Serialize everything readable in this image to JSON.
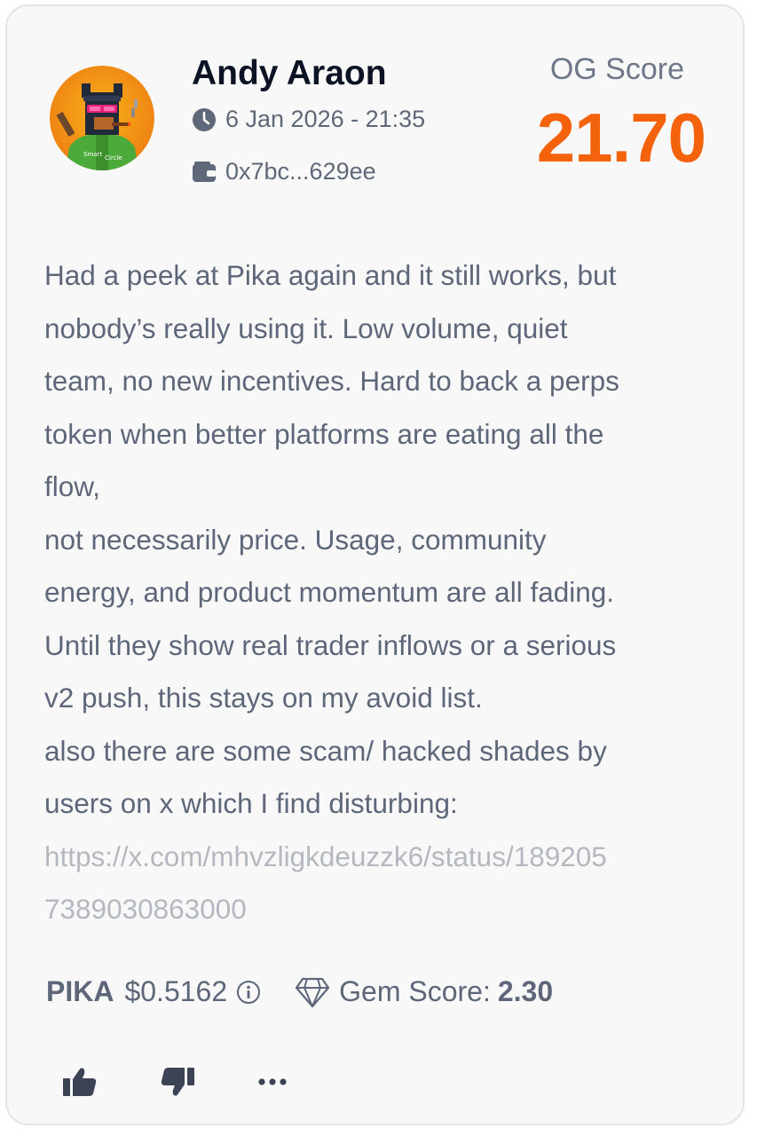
{
  "post": {
    "author": {
      "name": "Andy Araon",
      "avatar_icon": "pixel-dog-avatar",
      "avatar_caption": "Smart Circle"
    },
    "timestamp": "6 Jan 2026 - 21:35",
    "wallet": "0x7bc...629ee",
    "og_score": {
      "label": "OG Score",
      "value": "21.70",
      "color": "#f5620c"
    },
    "body_lines": [
      "Had a peek at Pika again and it still works, but",
      "nobody’s really using it. Low volume, quiet",
      "team, no new incentives. Hard to back a perps",
      "token when better platforms are eating all the",
      "flow,",
      "not necessarily price. Usage, community",
      "energy, and product momentum are all fading.",
      "Until they show real trader inflows or a serious",
      "v2 push, this stays on my avoid list.",
      "also there are some scam/ hacked shades by",
      "users on x which I find disturbing:"
    ],
    "link_lines": [
      "https://x.com/mhvzligkdeuzzk6/status/189205",
      "7389030863000"
    ],
    "token": {
      "symbol": "PIKA",
      "price": "$0.5162",
      "info_icon": "info-icon",
      "gem_icon": "diamond-icon",
      "gem_label": "Gem Score:",
      "gem_value": "2.30"
    },
    "actions": {
      "like_icon": "thumbs-up-icon",
      "dislike_icon": "thumbs-down-icon",
      "more_icon": "more-dots-icon"
    }
  }
}
